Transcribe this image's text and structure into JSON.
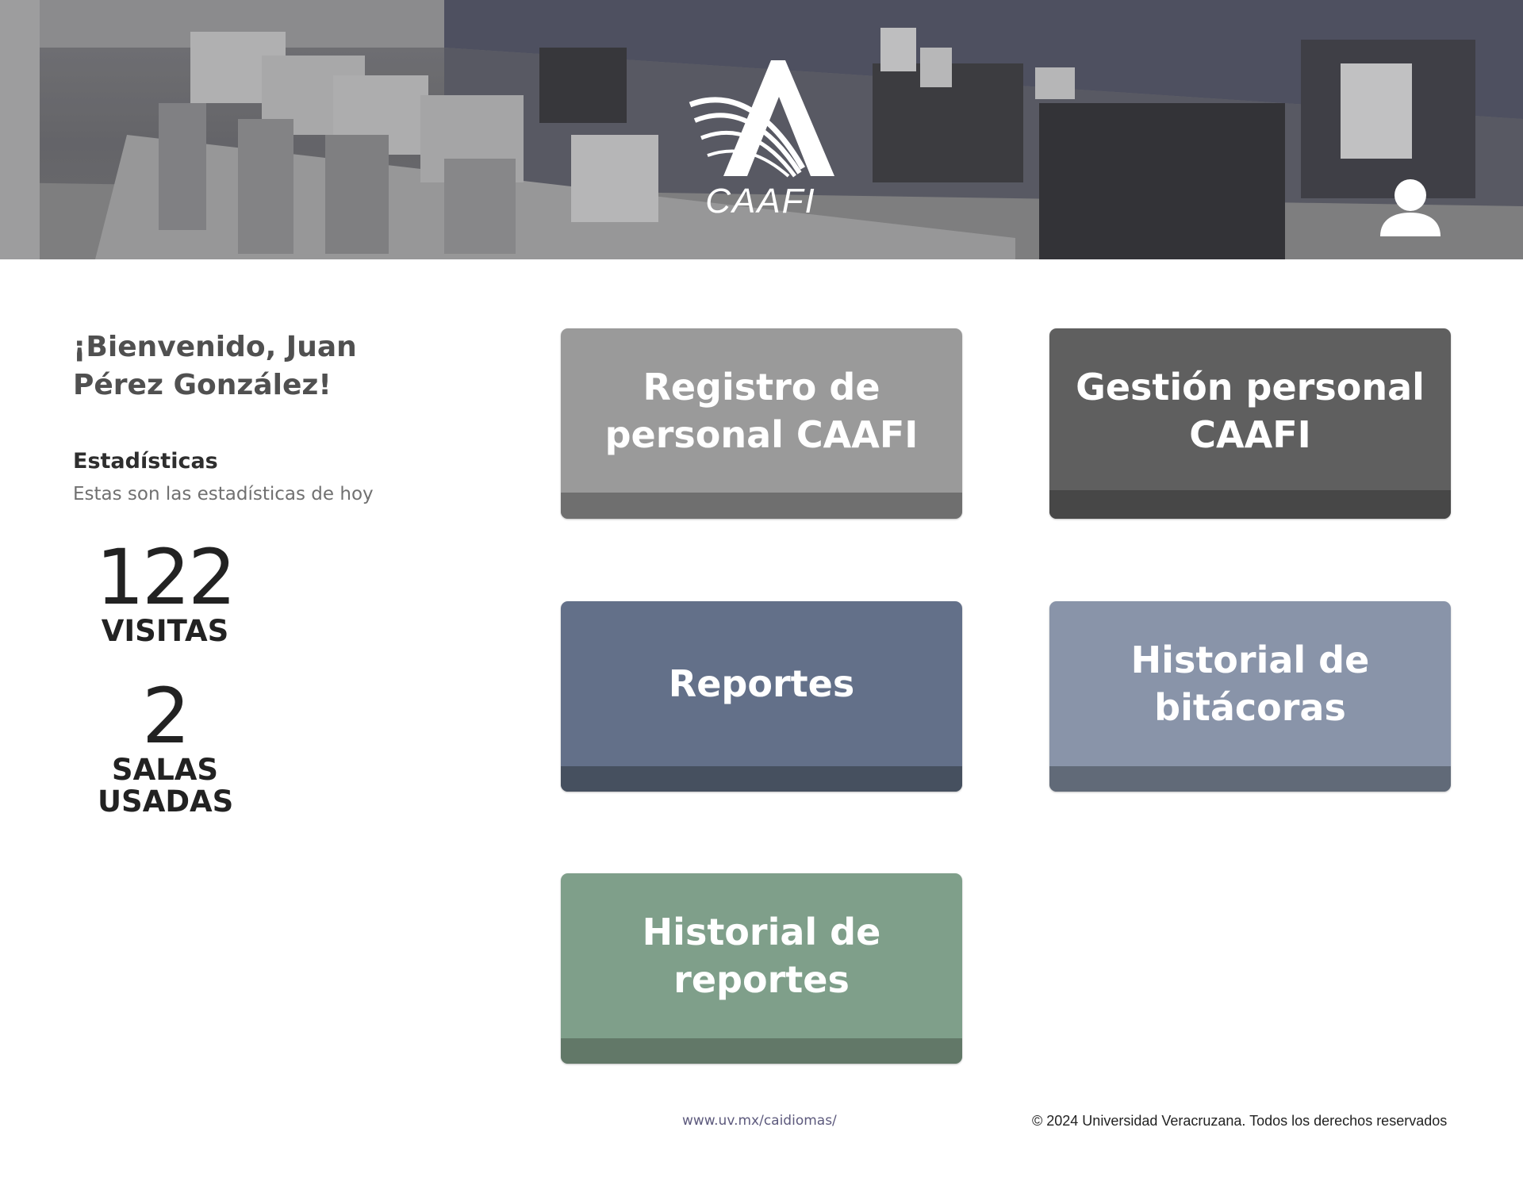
{
  "header": {
    "logo_text": "CAAFI",
    "user_icon": "user-account-icon"
  },
  "welcome": {
    "text": "¡Bienvenido, Juan Pérez González!"
  },
  "stats": {
    "title": "Estadísticas",
    "subtitle": "Estas son las estadísticas de hoy",
    "visits": {
      "value": "122",
      "label": "VISITAS"
    },
    "rooms": {
      "value": "2",
      "label": "SALAS USADAS"
    }
  },
  "tiles": [
    {
      "label": "Registro de personal CAAFI",
      "color": "#9a9a9a"
    },
    {
      "label": "Gestión personal CAAFI",
      "color": "#5f5f5f"
    },
    {
      "label": "Reportes",
      "color": "#637089"
    },
    {
      "label": "Historial de bitácoras",
      "color": "#8994a9"
    },
    {
      "label": "Historial de reportes",
      "color": "#7f9f8a"
    }
  ],
  "footer": {
    "link": "www.uv.mx/caidiomas/",
    "copyright": "© 2024 Universidad Veracruzana. Todos los derechos reservados"
  }
}
